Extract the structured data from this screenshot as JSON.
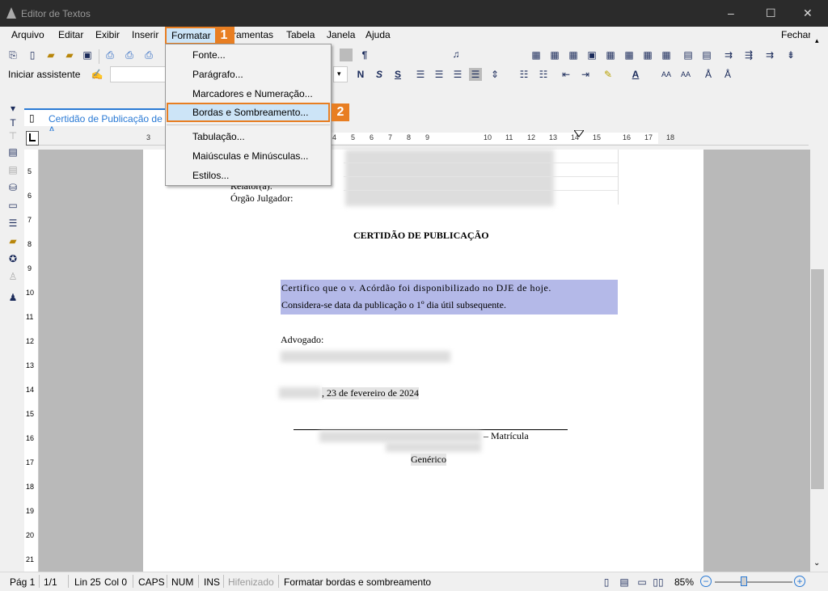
{
  "window": {
    "title": "Editor de Textos",
    "minimize": "–",
    "maximize": "☐",
    "close": "✕"
  },
  "menu": {
    "items": [
      "Arquivo",
      "Editar",
      "Exibir",
      "Inserir",
      "Formatar",
      "ramentas",
      "Tabela",
      "Janela",
      "Ajuda"
    ],
    "close": "Fechar"
  },
  "toolbar": {
    "assistant_label": "Iniciar assistente"
  },
  "tab": {
    "label": "Certidão de Publicação de A"
  },
  "ruler": {
    "h_numbers": [
      "3",
      "4",
      "5",
      "6",
      "7",
      "8",
      "9",
      "10",
      "11",
      "12",
      "13",
      "14",
      "15",
      "16",
      "17",
      "18"
    ],
    "v_numbers": [
      "5",
      "6",
      "7",
      "8",
      "9",
      "10",
      "11",
      "12",
      "13",
      "14",
      "15",
      "16",
      "17",
      "18",
      "19",
      "20",
      "21"
    ]
  },
  "format_menu": {
    "items": [
      "Fonte...",
      "Parágrafo...",
      "Marcadores e Numeração...",
      "Bordas e Sombreamento...",
      "Tabulação...",
      "Maiúsculas e Minúsculas...",
      "Estilos..."
    ],
    "highlighted": "Bordas e Sombreamento..."
  },
  "badges": {
    "b1": "1",
    "b2": "2"
  },
  "document": {
    "relator": "Relator(a):",
    "orgao": "Órgão Julgador:",
    "heading": "CERTIDÃO DE PUBLICAÇÃO",
    "para1": "Certifico que o v. Acórdão foi disponibilizado no DJE de hoje.",
    "para2": "Considera-se data da publicação o 1º dia útil subsequente.",
    "advogado": "Advogado:",
    "date": ", 23 de fevereiro de 2024",
    "matricula": "– Matrícula",
    "generico": "Genérico"
  },
  "status": {
    "page": "Pág 1",
    "pages": "1/1",
    "line": "Lin 25",
    "col": "Col 0",
    "caps": "CAPS",
    "num": "NUM",
    "ins": "INS",
    "hifen": "Hifenizado",
    "message": "Formatar bordas e sombreamento",
    "zoom": "85%"
  },
  "colors": {
    "accent": "#e87e22",
    "highlight": "#cce4f7",
    "selection": "#b4b9e8"
  }
}
